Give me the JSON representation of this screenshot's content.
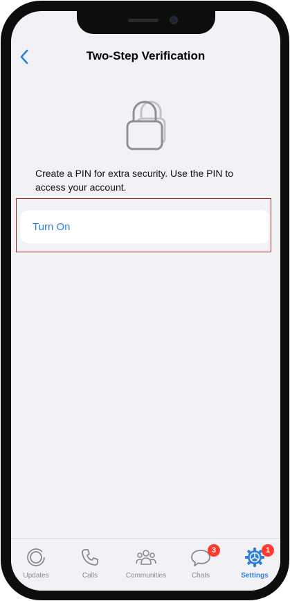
{
  "nav": {
    "title": "Two-Step Verification",
    "back_icon": "chevron-left-icon"
  },
  "content": {
    "lock_icon": "lock-icon",
    "description": "Create a PIN for extra security. Use the PIN to access your account.",
    "turn_on_label": "Turn On"
  },
  "tab_bar": {
    "tabs": [
      {
        "label": "Updates",
        "icon": "updates-icon",
        "active": false
      },
      {
        "label": "Calls",
        "icon": "phone-icon",
        "active": false
      },
      {
        "label": "Communities",
        "icon": "communities-icon",
        "active": false
      },
      {
        "label": "Chats",
        "icon": "chat-bubble-icon",
        "active": false,
        "badge": "3"
      },
      {
        "label": "Settings",
        "icon": "gear-icon",
        "active": true,
        "badge": "1"
      }
    ]
  },
  "colors": {
    "accent": "#2f7fd8",
    "badge": "#ff3b30",
    "highlight": "#a8211f",
    "background": "#f1f1f6"
  }
}
